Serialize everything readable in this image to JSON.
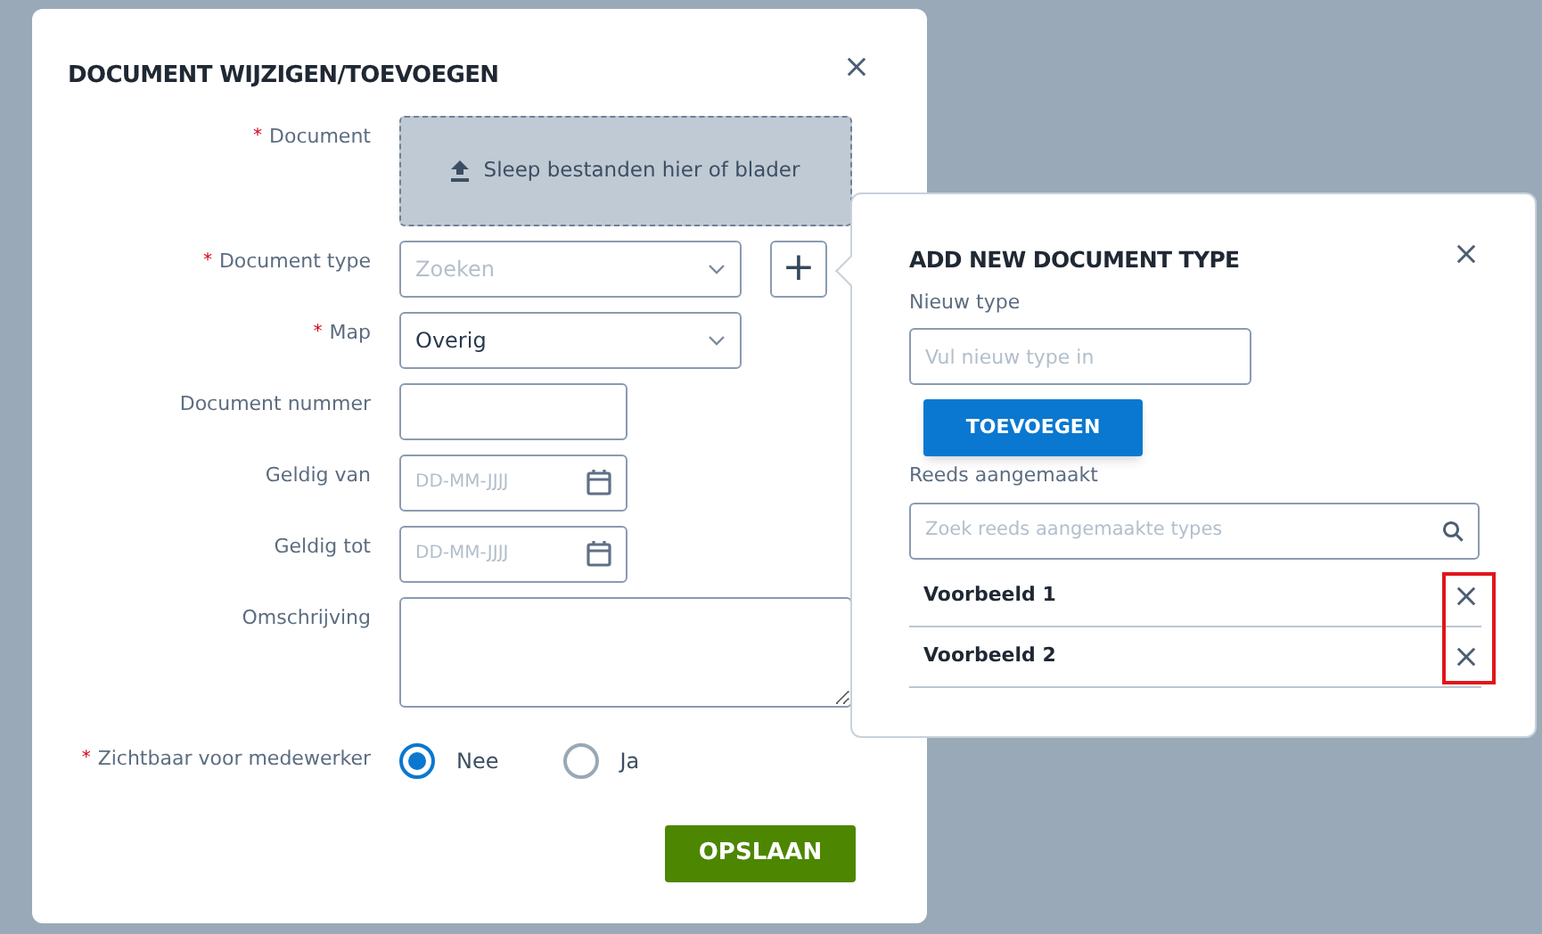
{
  "dialog": {
    "title": "DOCUMENT WIJZIGEN/TOEVOEGEN",
    "fields": [
      {
        "kind": "upload",
        "label": "Document",
        "required_mark": "*",
        "text": "Sleep bestanden hier of blader"
      },
      {
        "kind": "select",
        "label": "Document type",
        "required_mark": "*",
        "placeholder": "Zoeken",
        "add_button": "+"
      },
      {
        "kind": "select",
        "label": "Map",
        "required_mark": "*",
        "value": "Overig"
      },
      {
        "kind": "text",
        "label": "Document nummer"
      },
      {
        "kind": "date",
        "label": "Geldig van",
        "placeholder": "DD-MM-JJJJ"
      },
      {
        "kind": "date",
        "label": "Geldig tot",
        "placeholder": "DD-MM-JJJJ"
      },
      {
        "kind": "textarea",
        "label": "Omschrijving"
      },
      {
        "kind": "radio",
        "label": "Zichtbaar voor medewerker",
        "required_mark": "*",
        "options": [
          {
            "label": "Nee",
            "selected": true
          },
          {
            "label": "Ja",
            "selected": false
          }
        ]
      }
    ],
    "save_button": "OPSLAAN"
  },
  "popover": {
    "title": "ADD NEW DOCUMENT TYPE",
    "new_type_label": "Nieuw type",
    "new_type_placeholder": "Vul nieuw type in",
    "add_button": "TOEVOEGEN",
    "existing_label": "Reeds aangemaakt",
    "search_placeholder": "Zoek reeds aangemaakte types",
    "existing_types": [
      {
        "name": "Voorbeeld 1"
      },
      {
        "name": "Voorbeeld 2"
      }
    ],
    "delete_highlighted": true
  }
}
